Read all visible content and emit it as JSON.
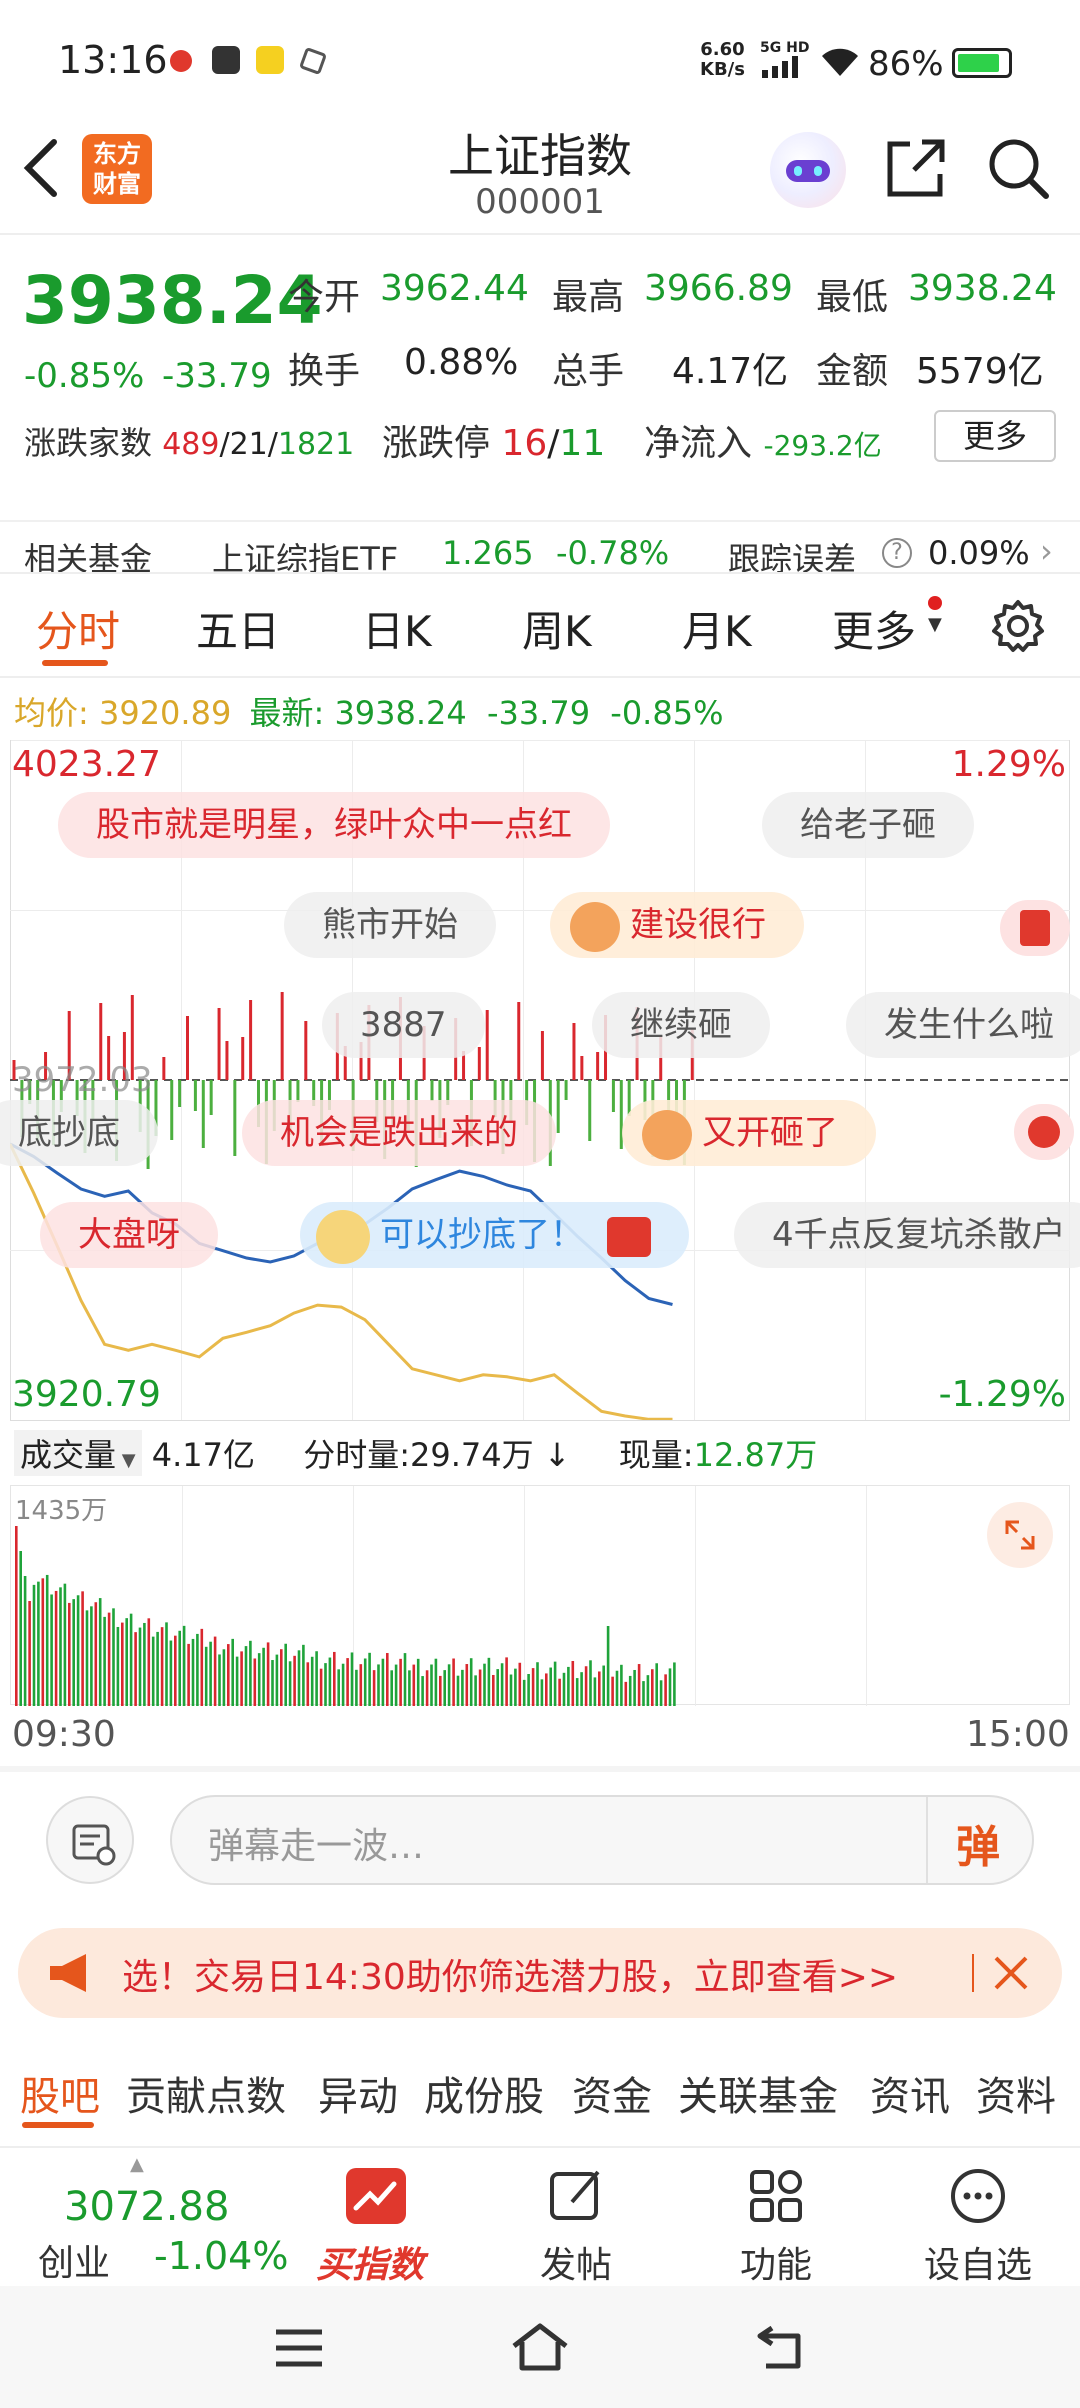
{
  "status_bar": {
    "time": "13:16",
    "net_speed": "6.60",
    "net_speed_unit": "KB/s",
    "network": "5G HD",
    "battery": "86%"
  },
  "header": {
    "logo_text_1": "东方",
    "logo_text_2": "财富",
    "title": "上证指数",
    "code": "000001"
  },
  "quote": {
    "price": "3938.24",
    "change_pct": "-0.85%",
    "change": "-33.79",
    "open_label": "今开",
    "open": "3962.44",
    "high_label": "最高",
    "high": "3966.89",
    "low_label": "最低",
    "low": "3938.24",
    "turnover_label": "换手",
    "turnover": "0.88%",
    "volume_label": "总手",
    "volume": "4.17亿",
    "amount_label": "金额",
    "amount": "5579亿",
    "breadth_label": "涨跌家数",
    "breadth_up": "489",
    "breadth_flat": "21",
    "breadth_down": "1821",
    "limit_label": "涨跌停",
    "limit_up": "16",
    "limit_down": "11",
    "netflow_label": "净流入",
    "netflow": "-293.2亿",
    "more_button": "更多"
  },
  "fund_row": {
    "label": "相关基金",
    "fund_name": "上证综指ETF",
    "fund_price": "1.265",
    "fund_change": "-0.78%",
    "tracking_label": "跟踪误差",
    "tracking_value": "0.09%"
  },
  "chart_tabs": [
    "分时",
    "五日",
    "日K",
    "周K",
    "月K",
    "更多"
  ],
  "chart_header": {
    "avg_label": "均价:",
    "avg": "3920.89",
    "latest_label": "最新:",
    "latest": "3938.24",
    "change": "-33.79",
    "change_pct": "-0.85%"
  },
  "chart_data": {
    "type": "line",
    "y_max_label": "4023.27",
    "y_min_label": "3920.79",
    "y_right_max": "1.29%",
    "y_right_min": "-1.29%",
    "prev_close_label": "3972.03",
    "ylim": [
      3920.79,
      4023.27
    ],
    "x_start": "09:30",
    "x_end": "15:00",
    "series": [
      {
        "name": "最新",
        "values": [
          3962.4,
          3960.5,
          3958.0,
          3955.6,
          3954.5,
          3955.3,
          3952.0,
          3950.3,
          3947.4,
          3946.3,
          3945.2,
          3944.6,
          3945.5,
          3947.4,
          3948.6,
          3950.3,
          3952.8,
          3955.6,
          3957.0,
          3958.3,
          3957.5,
          3956.2,
          3955.3,
          3951.9,
          3948.4,
          3945.2,
          3941.8,
          3939.1,
          3938.2
        ]
      },
      {
        "name": "均价",
        "values": [
          3962.4,
          3955.0,
          3947.0,
          3938.8,
          3932.2,
          3931.3,
          3932.2,
          3931.3,
          3930.3,
          3933.1,
          3934.0,
          3935.0,
          3936.9,
          3938.1,
          3937.8,
          3935.9,
          3932.2,
          3928.5,
          3927.6,
          3926.7,
          3927.6,
          3927.3,
          3926.7,
          3927.6,
          3924.8,
          3922.1,
          3921.4,
          3920.9,
          3920.9
        ]
      }
    ],
    "volume": {
      "label": "成交量",
      "total": "4.17亿",
      "minute_label": "分时量:",
      "minute_value": "29.74万",
      "current_label": "现量:",
      "current_value": "12.87万",
      "max_label": "1435万"
    }
  },
  "danmu": [
    "股市就是明星，绿叶众中一点红",
    "给老子砸",
    "熊市开始",
    "建设很行",
    "3887",
    "继续砸",
    "发生什么啦",
    "底抄底",
    "机会是跌出来的",
    "又开砸了",
    "大盘呀",
    "可以抄底了！",
    "4千点反复坑杀散户"
  ],
  "danmu_input": {
    "placeholder": "弹幕走一波…",
    "send_label": "弹"
  },
  "banner": {
    "text": "选！交易日14:30助你筛选潜力股，立即查看>>"
  },
  "bottom_tabs": [
    "股吧",
    "贡献点数",
    "异动",
    "成份股",
    "资金",
    "关联基金",
    "资讯",
    "资料"
  ],
  "bottom_nav": {
    "mini_quote_value": "3072.88",
    "mini_quote_name": "创业",
    "mini_quote_change": "-1.04%",
    "buy_label": "买指数",
    "post_label": "发帖",
    "func_label": "功能",
    "watch_label": "设自选"
  },
  "colors": {
    "accent": "#e5561c",
    "up": "#d9272e",
    "down": "#1a9b2d",
    "avg_line": "#e8b94a",
    "price_line": "#2b63b6"
  }
}
